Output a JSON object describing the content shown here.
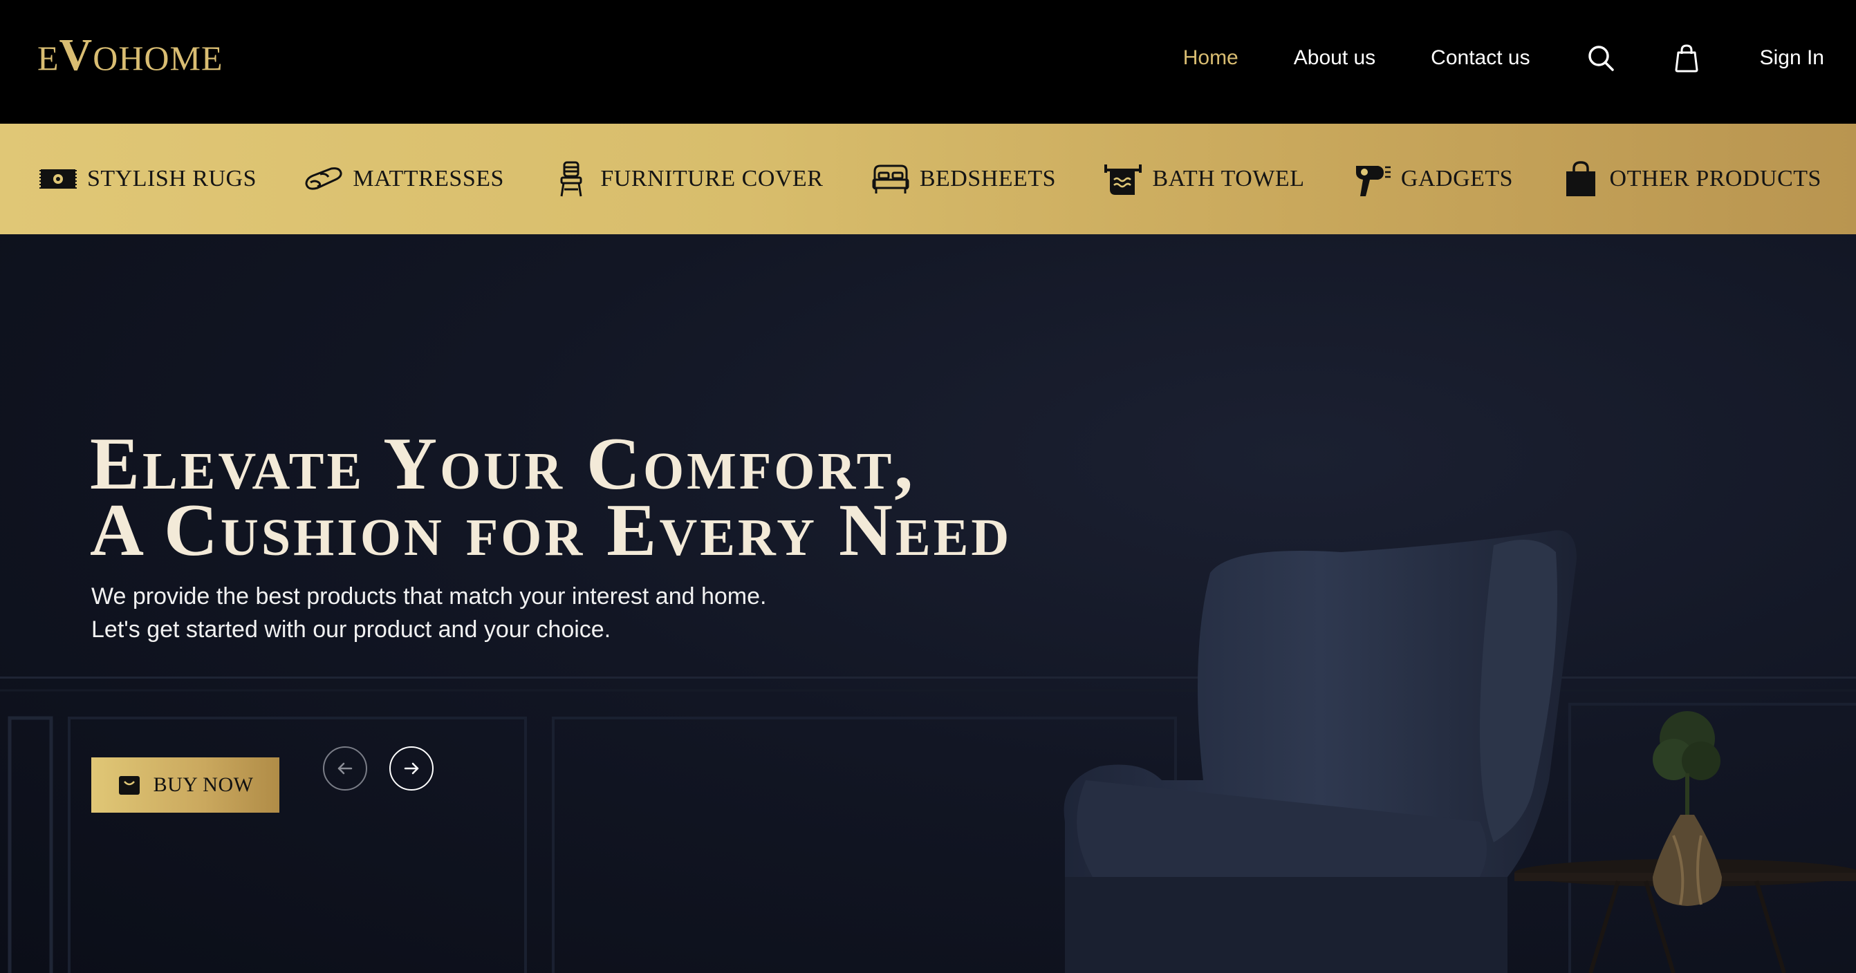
{
  "brand": {
    "logo_prefix": "E",
    "logo_v": "V",
    "logo_suffix": "OHOME",
    "gold": "#d9bd72"
  },
  "nav": {
    "links": [
      {
        "label": "Home",
        "active": true
      },
      {
        "label": "About us",
        "active": false
      },
      {
        "label": "Contact us",
        "active": false
      }
    ],
    "search_icon": "search-icon",
    "cart_icon": "shopping-bag-icon",
    "signin_label": "Sign In"
  },
  "categories": [
    {
      "label": "STYLISH RUGS",
      "icon": "rug-icon"
    },
    {
      "label": "MATTRESSES",
      "icon": "mattress-icon"
    },
    {
      "label": "FURNITURE COVER",
      "icon": "chair-icon"
    },
    {
      "label": "BEDSHEETS",
      "icon": "bed-icon"
    },
    {
      "label": "BATH TOWEL",
      "icon": "towel-icon"
    },
    {
      "label": "GADGETS",
      "icon": "hair-dryer-icon"
    },
    {
      "label": "OTHER PRODUCTS",
      "icon": "bag-icon"
    }
  ],
  "hero": {
    "title_line1": "Elevate Your Comfort,",
    "title_line2": "A Cushion for Every Need",
    "subtitle_line1": "We provide the best products that match your interest and home.",
    "subtitle_line2": "Let's get started with our product and your choice.",
    "cta_label": "BUY NOW",
    "prev_icon": "arrow-left-icon",
    "next_icon": "arrow-right-icon"
  }
}
